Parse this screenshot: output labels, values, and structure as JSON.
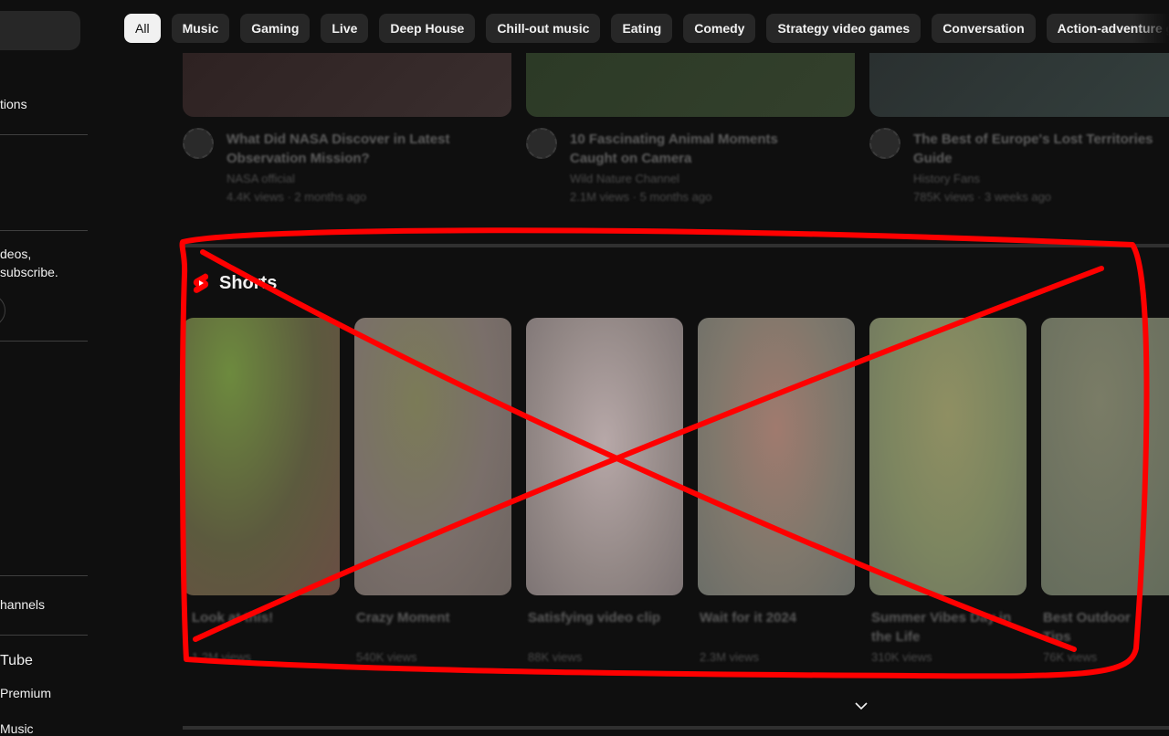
{
  "sidebar": {
    "subscriptions_label": "tions",
    "signin_text_line1": "deos,",
    "signin_text_line2": "subscribe.",
    "browse_channels_label": "hannels",
    "more_from_heading": "Tube",
    "premium_label": "Premium",
    "music_label": "Music"
  },
  "chips": [
    "All",
    "Music",
    "Gaming",
    "Live",
    "Deep House",
    "Chill-out music",
    "Eating",
    "Comedy",
    "Strategy video games",
    "Conversation",
    "Action-adventure games"
  ],
  "active_chip": "All",
  "top_videos": [
    {
      "title": "What Did NASA Discover in Latest",
      "line2": "Observation Mission?",
      "meta1": "NASA official",
      "meta2": "4.4K views · 2 months ago"
    },
    {
      "title": "10 Fascinating Animal Moments",
      "line2": "Caught on Camera",
      "meta1": "Wild Nature Channel",
      "meta2": "2.1M views · 5 months ago"
    },
    {
      "title": "The Best of Europe's Lost Territories",
      "line2": "Guide",
      "meta1": "History Fans",
      "meta2": "785K views · 3 weeks ago"
    }
  ],
  "shorts": {
    "title": "Shorts",
    "items": [
      {
        "title": "Look at this!",
        "views": "1.2M views"
      },
      {
        "title": "Crazy Moment",
        "views": "540K views"
      },
      {
        "title": "Satisfying video clip",
        "views": "88K views"
      },
      {
        "title": "Wait for it 2024",
        "views": "2.3M views"
      },
      {
        "title": "Summer Vibes Day in the Life",
        "views": "310K views"
      },
      {
        "title": "Best Outdoor Tips",
        "views": "76K views"
      }
    ]
  },
  "colors": {
    "background": "#0f0f0f",
    "chip": "#272727",
    "chip_active": "#f1f1f1",
    "annotation": "#ff0000",
    "shorts_logo": "#ff0000"
  }
}
